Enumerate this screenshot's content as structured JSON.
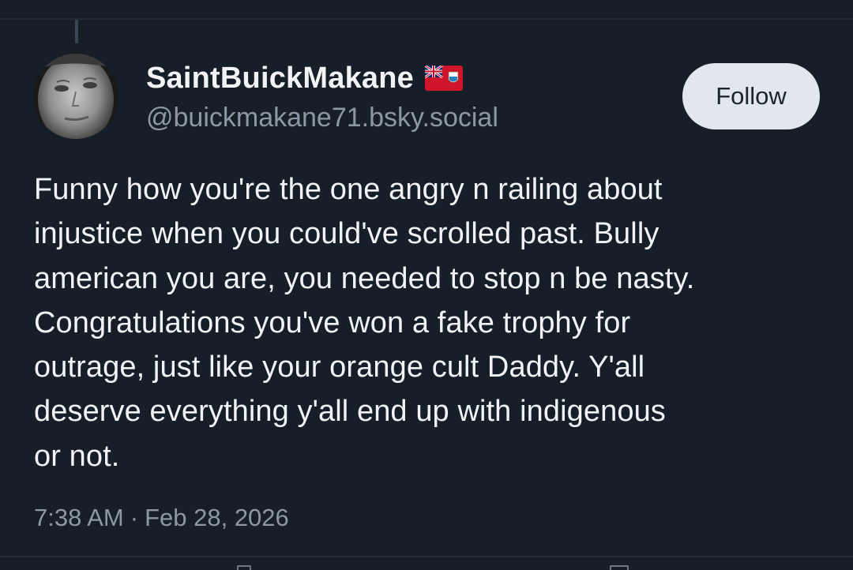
{
  "post": {
    "author": {
      "display_name": "SaintBuickMakane",
      "handle": "@buickmakane71.bsky.social",
      "flag_icon": "bermuda-flag-icon",
      "avatar_icon": "profile-photo"
    },
    "follow_label": "Follow",
    "text_lines": [
      "Funny how you're the one angry n railing about",
      "injustice when you could've scrolled past. Bully",
      "american you are, you needed to stop n be nasty.",
      "Congratulations you've won a fake trophy for",
      "outrage, just like your orange cult Daddy. Y'all",
      "deserve everything y'all end up with indigenous",
      "or not."
    ],
    "time": "7:38 AM",
    "date_separator": "·",
    "date": "Feb 28, 2026"
  },
  "colors": {
    "background": "#161e27",
    "text_primary": "#f1f3f5",
    "text_secondary": "#8c98a6",
    "follow_button_bg": "#e2e7ee",
    "follow_button_text": "#1b232d"
  }
}
